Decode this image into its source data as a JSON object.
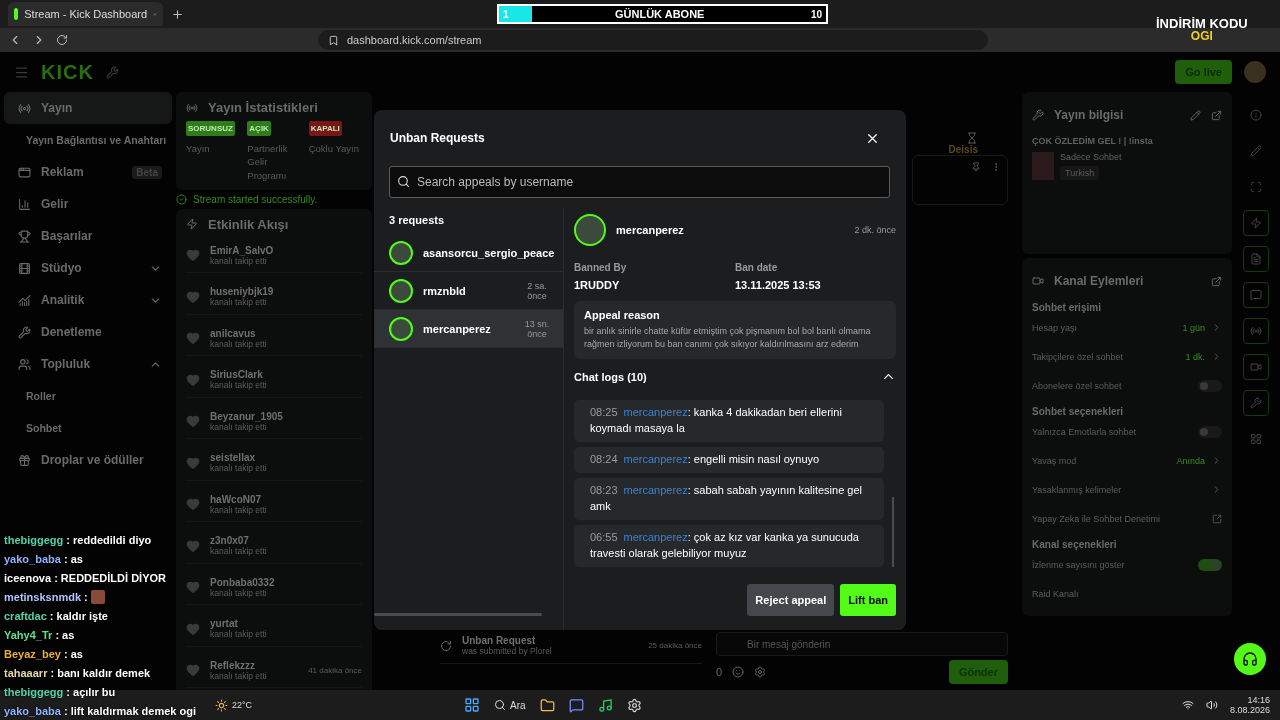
{
  "browser": {
    "tab_title": "Stream - Kick Dashboard",
    "url": "dashboard.kick.com/stream"
  },
  "stream_overlay": {
    "goal": {
      "current": "1",
      "label": "GÜNLÜK ABONE",
      "target": "10",
      "level": 0.1
    },
    "promo": [
      "İNDİRİM KODU",
      "OGI"
    ],
    "chat": [
      {
        "user": "thebiggegg",
        "text": " : reddedildi diyo",
        "color": "#4fd6a8",
        "kind": "text"
      },
      {
        "user": "yako_baba",
        "text": " : as",
        "color": "#8fb4ff",
        "kind": "text"
      },
      {
        "user": "iceenova",
        "text": " : REDDEDİLDİ DİYOR",
        "color": "#ffffff",
        "kind": "text"
      },
      {
        "user": "metinsksnmdk",
        "text": " : ",
        "color": "#b4c4ff",
        "kind": "emote"
      },
      {
        "user": "craftdac",
        "text": " : kaldır işte",
        "color": "#4fd6a8",
        "kind": "text"
      },
      {
        "user": "Yahy4_Tr",
        "text": " : as",
        "color": "#5ee08a",
        "kind": "text"
      },
      {
        "user": "Beyaz_bey",
        "text": " : as",
        "color": "#f0b030",
        "kind": "text"
      },
      {
        "user": "tahaaarr",
        "text": " : banı kaldır demek",
        "color": "#e6d7a8",
        "kind": "text"
      },
      {
        "user": "thebiggegg",
        "text": " : açılır bu",
        "color": "#4fd6a8",
        "kind": "text"
      },
      {
        "user": "yako_baba",
        "text": " : lift kaldırmak demek ogi",
        "color": "#8fb4ff",
        "kind": "text"
      }
    ]
  },
  "topbar": {
    "logo": "KICK",
    "go_live": "Go live"
  },
  "sidebar": [
    {
      "label": "Yayın",
      "selected": true,
      "children": [
        {
          "label": "Yayın Bağlantısı ve Anahtarı",
          "selected": false
        }
      ]
    },
    {
      "label": "Reklam",
      "badge": "Beta",
      "selected": false
    },
    {
      "label": "Gelir",
      "selected": false
    },
    {
      "label": "Başarılar",
      "selected": false
    },
    {
      "label": "Stüdyo",
      "selected": false,
      "expanded": false
    },
    {
      "label": "Analitik",
      "selected": false,
      "expanded": false
    },
    {
      "label": "Denetleme",
      "selected": false
    },
    {
      "label": "Topluluk",
      "selected": false,
      "expanded": true,
      "children": [
        {
          "label": "Roller",
          "selected": false
        },
        {
          "label": "Sohbet",
          "selected": false
        }
      ]
    },
    {
      "label": "Droplar ve ödüller",
      "selected": false
    }
  ],
  "stats": {
    "title": "Yayın İstatistikleri",
    "items": [
      {
        "status": "SORUNSUZ",
        "label": "Yayın",
        "color": "#2f7d1a"
      },
      {
        "status": "AÇIK",
        "label": "Partnerlik Gelir Programı",
        "color": "#2f7d1a"
      },
      {
        "status": "KAPALI",
        "label": "Çoklu Yayın",
        "color": "#7a1518"
      }
    ],
    "notice": "Stream started successfully."
  },
  "activity": {
    "title": "Etkinlik Akışı",
    "events": [
      {
        "user": "EmirA_SalvO",
        "action": "kanalı takip etti"
      },
      {
        "user": "huseniybjk19",
        "action": "kanalı takip etti"
      },
      {
        "user": "anilcavus",
        "action": "kanalı takip etti"
      },
      {
        "user": "SiriusClark",
        "action": "kanalı takip etti"
      },
      {
        "user": "Beyzanur_1905",
        "action": "kanalı takip etti"
      },
      {
        "user": "seistellax",
        "action": "kanalı takip etti"
      },
      {
        "user": "haWcoN07",
        "action": "kanalı takip etti"
      },
      {
        "user": "z3n0x07",
        "action": "kanalı takip etti"
      },
      {
        "user": "Ponbaba0332",
        "action": "kanalı takip etti"
      },
      {
        "user": "yurtat",
        "action": "kanalı takip etti"
      },
      {
        "user": "Reflekzzz",
        "action": "kanalı takip etti",
        "time": "41 dakika önce"
      }
    ]
  },
  "middle": {
    "events": [
      {
        "title": "Unban Request",
        "detail": "was submitted by ",
        "user": "Plorel",
        "time": "25 dakika önce"
      }
    ]
  },
  "chat_panel": {
    "chip": "Deisis",
    "placeholder": "Bir mesaj gönderin",
    "count": "0",
    "send": "Gönder"
  },
  "stream_info": {
    "title": "Yayın bilgisi",
    "stream_title": "ÇOK ÖZLEDİM GEL ! | !insta",
    "category": "Sadece Sohbet",
    "tag": "Turkish"
  },
  "channel_actions": {
    "title": "Kanal Eylemleri",
    "sections": [
      {
        "title": "Sohbet erişimi",
        "rows": [
          {
            "label": "Hesap yaşı",
            "kind": "value",
            "value": "1 gün"
          },
          {
            "label": "Takipçilere özel sohbet",
            "kind": "value",
            "value": "1 dk."
          },
          {
            "label": "Abonelere özel sohbet",
            "kind": "toggle",
            "on": false
          }
        ]
      },
      {
        "title": "Sohbet seçenekleri",
        "rows": [
          {
            "label": "Yalnızca Emotlarla sohbet",
            "kind": "toggle",
            "on": false
          },
          {
            "label": "Yavaş mod",
            "kind": "value",
            "value": "Anında"
          },
          {
            "label": "Yasaklanmış kelimeler",
            "kind": "link"
          },
          {
            "label": "Yapay Zeka ile Sohbet Denetimi",
            "kind": "external"
          }
        ]
      },
      {
        "title": "Kanal seçenekleri",
        "rows": [
          {
            "label": "İzlenme sayısını göster",
            "kind": "toggle",
            "on": true
          },
          {
            "label": "Raid Kanalı",
            "kind": "plain"
          }
        ]
      }
    ]
  },
  "modal": {
    "title": "Unban Requests",
    "search_placeholder": "Search appeals by username",
    "count_label": "3 requests",
    "requests": [
      {
        "user": "asansorcu_sergio_peace",
        "selected": false
      },
      {
        "user": "rmznbld",
        "time": "2 sa. önce",
        "selected": false
      },
      {
        "user": "mercanperez",
        "time": "13 sn. önce",
        "selected": true
      }
    ],
    "detail": {
      "user": "mercanperez",
      "time": "2 dk. önce",
      "banned_by_label": "Banned By",
      "banned_by": "1RUDDY",
      "ban_date_label": "Ban date",
      "ban_date": "13.11.2025 13:53",
      "reason_title": "Appeal reason",
      "reason": "bir anlık sinirle chatte küfür etmiştim çok pişmanım bol bol banlı olmama rağmen izliyorum bu ban canımı çok sıkıyor kaldırılmasını arz ederim",
      "logs_title": "Chat logs (10)",
      "logs_expanded": true,
      "logs": [
        {
          "time": "08:25",
          "user": "mercanperez",
          "text": ": kanka 4 dakikadan beri ellerini koymadı masaya la"
        },
        {
          "time": "08:24",
          "user": "mercanperez",
          "text": ": engelli misin nasıl oynuyo"
        },
        {
          "time": "08:23",
          "user": "mercanperez",
          "text": ": sabah sabah yayının kalitesine gel amk"
        },
        {
          "time": "06:55",
          "user": "mercanperez",
          "text": ": çok az kız var kanka ya sunucuda travesti olarak gelebiliyor muyuz"
        }
      ],
      "buttons": [
        {
          "label": "Reject appeal",
          "kind": "secondary"
        },
        {
          "label": "Lift ban",
          "kind": "primary"
        }
      ]
    }
  },
  "taskbar": {
    "weather": "22°C",
    "search": "Ara",
    "time": "14:16",
    "date": "8.08.2026"
  }
}
